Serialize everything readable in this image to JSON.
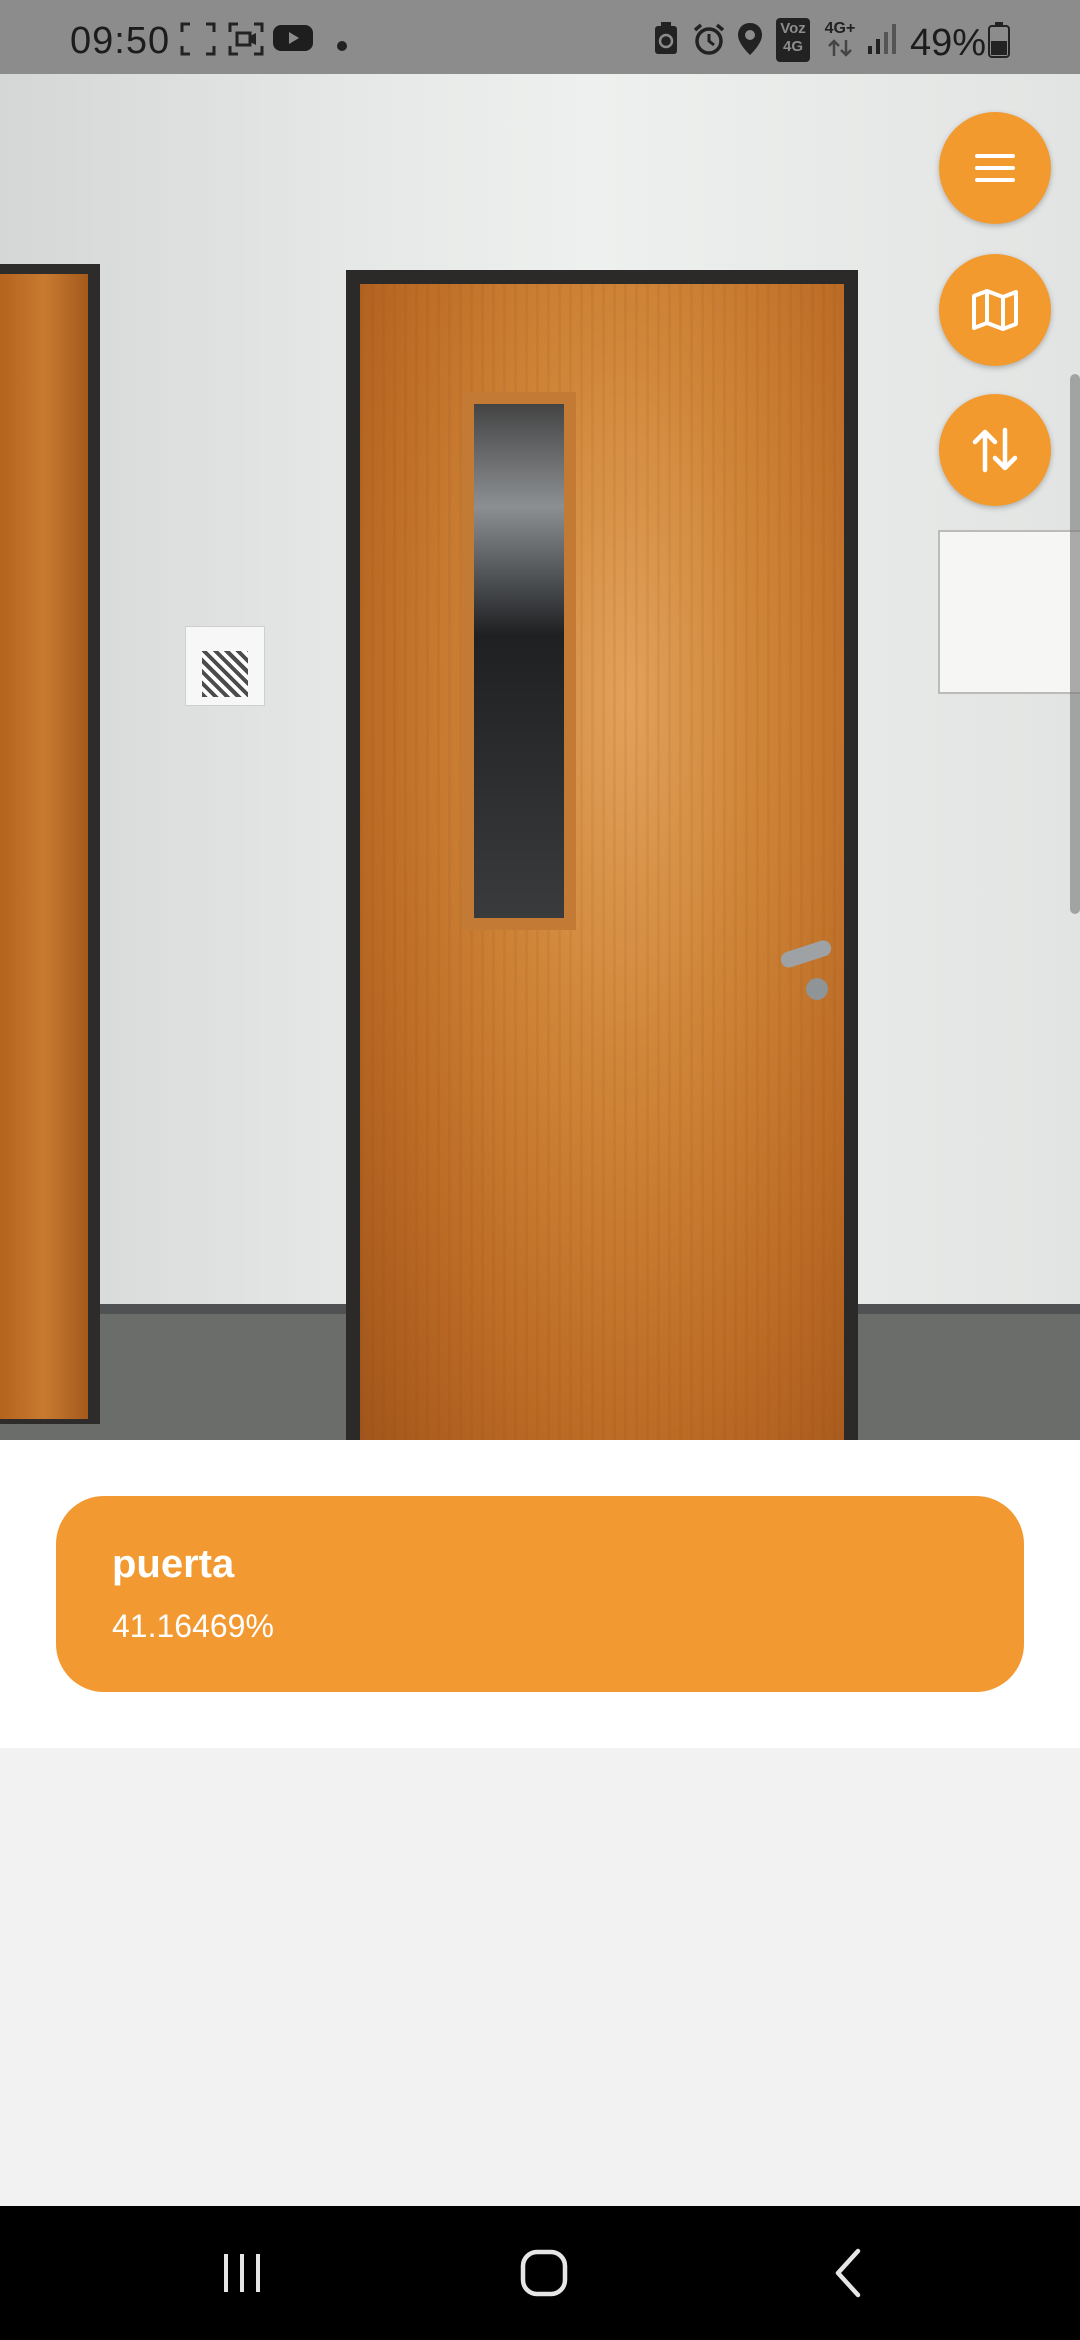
{
  "status_bar": {
    "time": "09:50",
    "network_voz": "Voz",
    "network_4g": "4G",
    "network_4g_plus": "4G+",
    "battery_percent": "49%",
    "icons": [
      "screenshot-icon",
      "screen-record-icon",
      "youtube-icon",
      "dot-icon",
      "recycle-icon",
      "alarm-icon",
      "location-icon",
      "signal-icon",
      "battery-icon"
    ]
  },
  "fabs": {
    "menu": "menu-icon",
    "map": "map-icon",
    "switch_camera": "swap-vertical-icon"
  },
  "result": {
    "label": "puerta",
    "confidence": "41.16469%"
  },
  "colors": {
    "accent": "#f39a2f",
    "card": "#f29a31",
    "navbar": "#000000",
    "background": "#f2f2f2"
  },
  "navbar": {
    "icons": [
      "recent-apps-icon",
      "home-icon",
      "back-icon"
    ]
  }
}
